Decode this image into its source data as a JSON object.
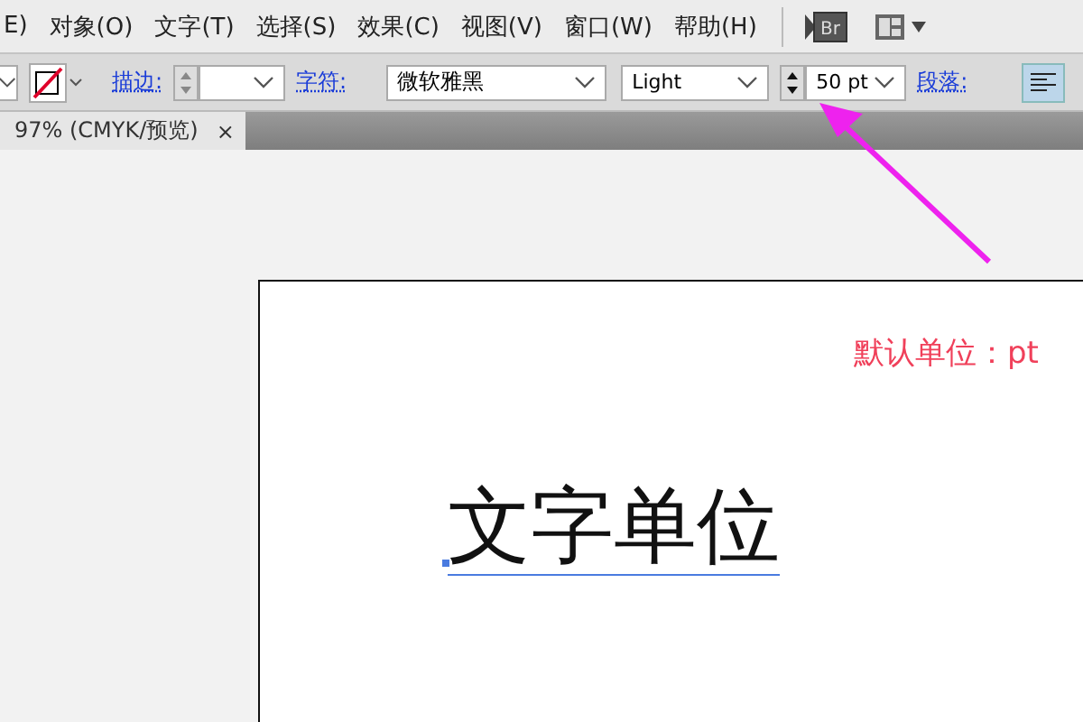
{
  "menu": [
    {
      "label": "E)"
    },
    {
      "label": "对象(O)"
    },
    {
      "label": "文字(T)"
    },
    {
      "label": "选择(S)"
    },
    {
      "label": "效果(C)"
    },
    {
      "label": "视图(V)"
    },
    {
      "label": "窗口(W)"
    },
    {
      "label": "帮助(H)"
    }
  ],
  "bridge_label": "Br",
  "toolbar": {
    "stroke_label": "描边:",
    "character_label": "字符:",
    "font": "微软雅黑",
    "style": "Light",
    "size": "50 pt",
    "paragraph_label": "段落:",
    "align_left": {
      "selected": true
    }
  },
  "document_tab": {
    "title": "97% (CMYK/预览)",
    "close": "×"
  },
  "artboard": {
    "note": "默认单位：pt",
    "text": "文字单位"
  }
}
